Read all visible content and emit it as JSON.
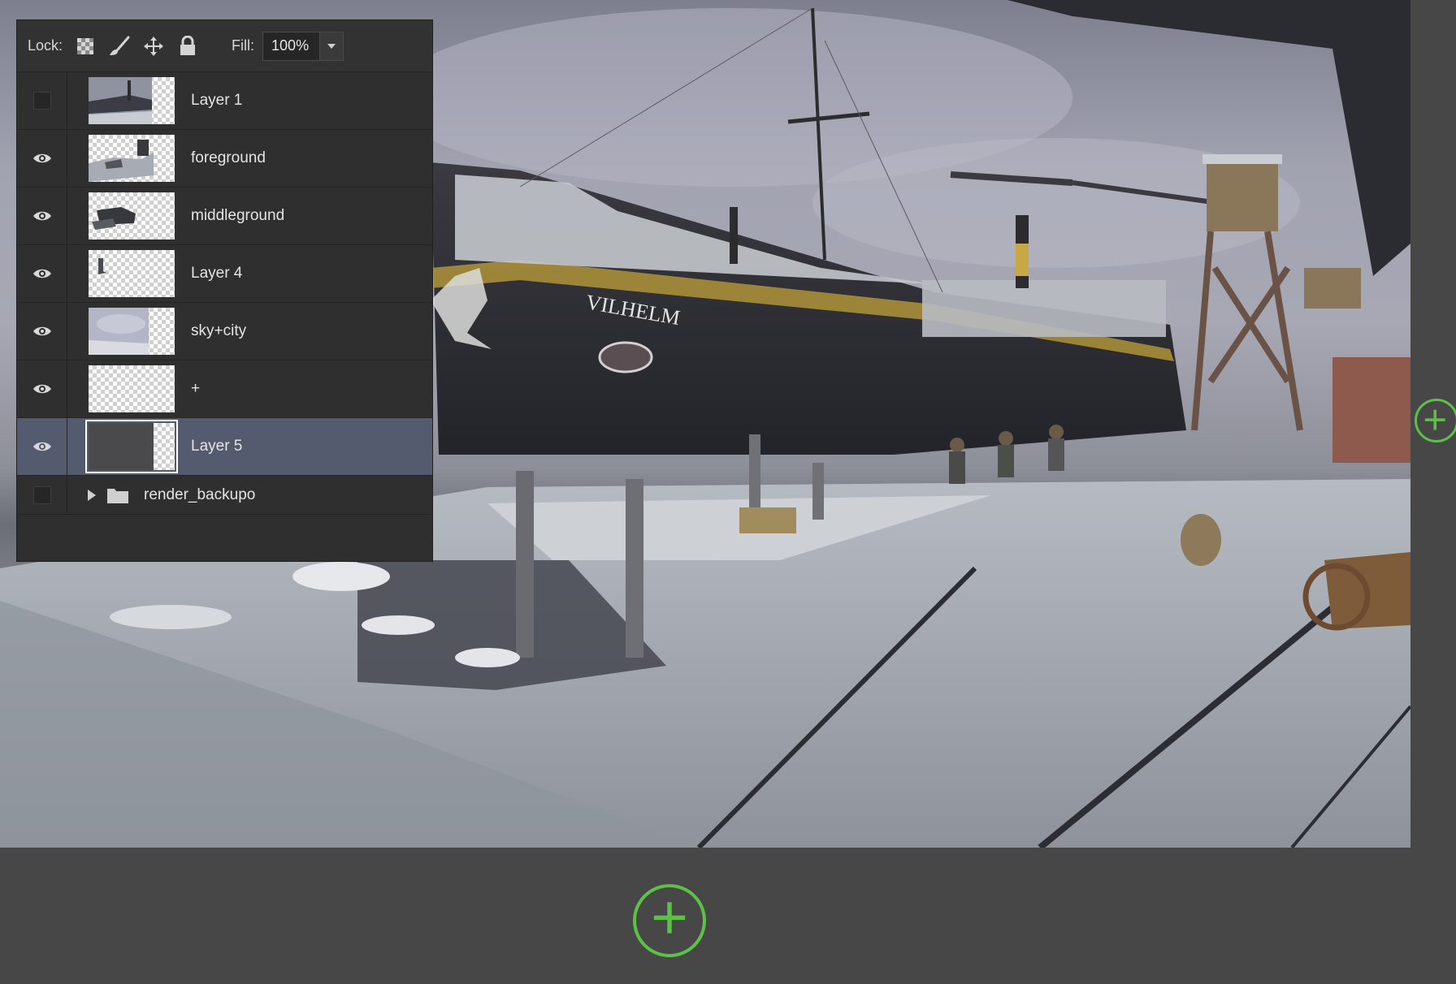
{
  "canvas": {
    "ship_name": "VILHELM"
  },
  "layers_panel": {
    "lock_label": "Lock:",
    "lock_icons": [
      "lock-transparent-pixels-icon",
      "lock-image-pixels-icon",
      "lock-position-icon",
      "lock-all-icon"
    ],
    "fill_label": "Fill:",
    "fill_value": "100%",
    "layers": [
      {
        "name": "Layer 1",
        "visible": false,
        "selected": false,
        "thumb": "photo"
      },
      {
        "name": "foreground",
        "visible": true,
        "selected": false,
        "thumb": "foreground"
      },
      {
        "name": "middleground",
        "visible": true,
        "selected": false,
        "thumb": "middleground"
      },
      {
        "name": "Layer 4",
        "visible": true,
        "selected": false,
        "thumb": "small-mark"
      },
      {
        "name": "sky+city",
        "visible": true,
        "selected": false,
        "thumb": "sky"
      },
      {
        "name": "+",
        "visible": true,
        "selected": false,
        "thumb": "empty"
      },
      {
        "name": "Layer 5",
        "visible": true,
        "selected": true,
        "thumb": "dark"
      }
    ],
    "group": {
      "name": "render_backupo",
      "visible": false,
      "expanded": false
    }
  },
  "colors": {
    "accent_green": "#5ec147",
    "selected_row": "#545b6f",
    "panel_bg": "#2f2f2f",
    "workspace_bg": "#474747"
  }
}
